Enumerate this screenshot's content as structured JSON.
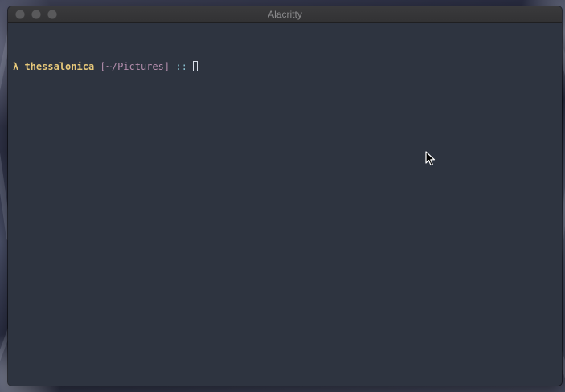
{
  "window": {
    "title": "Alacritty"
  },
  "terminal": {
    "prompt_symbol": "λ",
    "hostname": "thessalonica",
    "cwd": "[~/Pictures]",
    "separator": "::",
    "input": ""
  },
  "colors": {
    "terminal_background": "#2e3440",
    "hostname": "#e8c97a",
    "cwd": "#b48ead",
    "separator": "#88c0d0",
    "titlebar": "#363638"
  },
  "icons": {
    "window_close": "close-dot",
    "window_minimize": "minimize-dot",
    "window_zoom": "zoom-dot",
    "mouse": "arrow-pointer"
  }
}
